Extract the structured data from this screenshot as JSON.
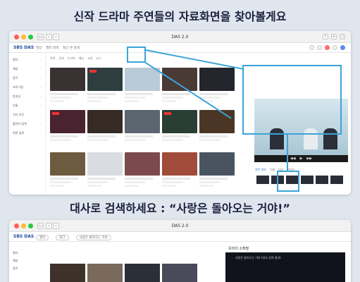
{
  "headline1": {
    "em": "신작 드라마 주연",
    "rest": "들의 자료화면을 찾아볼게요"
  },
  "headline2": {
    "plain": "대사로 검색하세요 : ",
    "quote": "“사랑은 돌아오는 거야!”"
  },
  "window1": {
    "title": "DAS 2.0",
    "logo": "SBS DAS",
    "menu": [
      "영상",
      "필터 검색",
      "최근 본 검색"
    ],
    "filters": [
      "전체",
      "공개",
      "드라마",
      "예능",
      "교양",
      "뉴스"
    ],
    "sidebar": [
      "필터",
      "채널",
      "장르",
      "프로그램",
      "방송일",
      "인물",
      "기타 조건",
      "출연자 검색",
      "연관 검색"
    ],
    "preview_tabs": [
      "장면 정보",
      "인물",
      "대사",
      "키워드"
    ]
  },
  "window2": {
    "title": "DAS 2.0",
    "logo": "SBS DAS",
    "chips": [
      "필터",
      "태그",
      "사랑은 돌아오는 거야"
    ],
    "sidebar": [
      "필터",
      "채널",
      "장르"
    ],
    "panel_title": "유비의 소확필",
    "panel_caption": "사랑은 돌아오는 거야 (대사 검색 결과)"
  },
  "colors": {
    "accent": "#3ba4d9",
    "brand": "#1c4b9b",
    "headline": "#1b1f3b"
  }
}
